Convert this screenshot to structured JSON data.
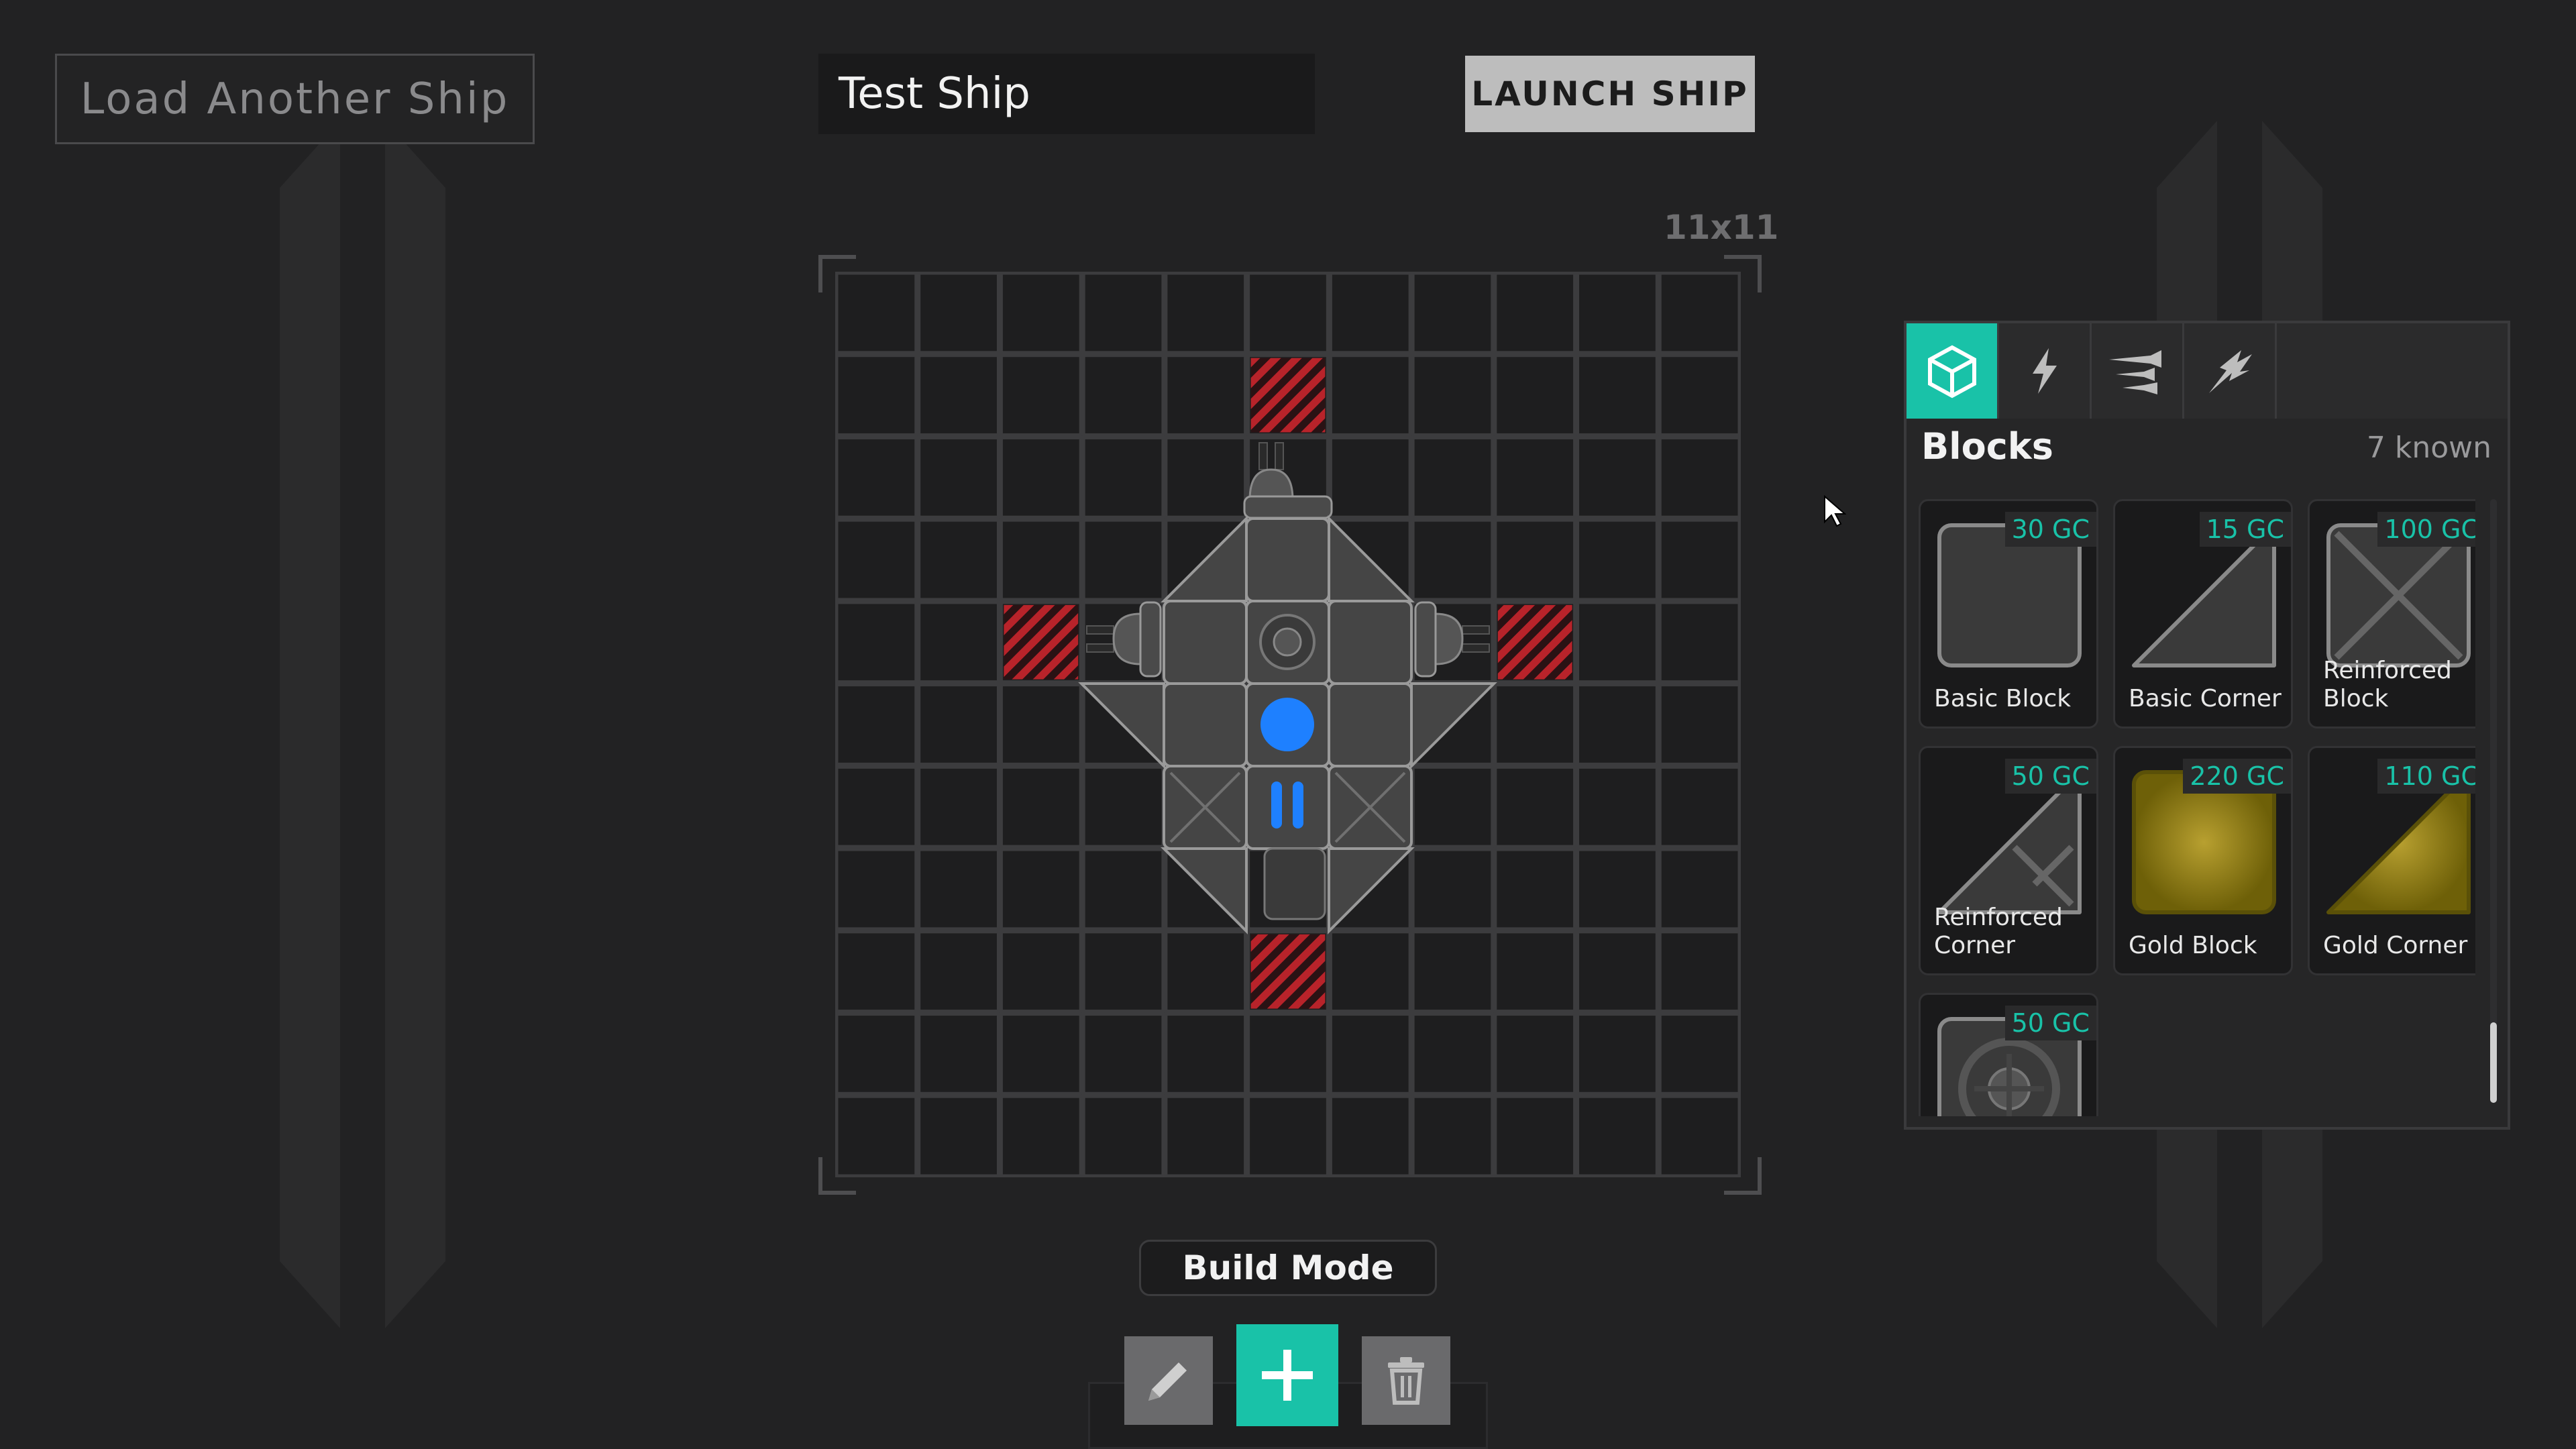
{
  "header": {
    "load_label": "Load Another Ship",
    "ship_name": "Test Ship",
    "launch_label": "LAUNCH SHIP"
  },
  "grid": {
    "size_label": "11x11",
    "cols": 11,
    "rows": 11,
    "blocked_cells": [
      [
        5,
        1
      ],
      [
        2,
        4
      ],
      [
        8,
        4
      ],
      [
        5,
        8
      ]
    ]
  },
  "mode": {
    "label": "Build Mode",
    "tools": [
      "pencil-icon",
      "plus-icon",
      "trash-icon"
    ],
    "active_tool": "plus-icon"
  },
  "palette": {
    "tabs": [
      "cube-icon",
      "lightning-icon",
      "thruster-icon",
      "weapon-icon"
    ],
    "active_tab": "cube-icon",
    "title": "Blocks",
    "count": "7 known",
    "items": [
      {
        "name": "Basic Block",
        "price": "30 GC",
        "kind": "block"
      },
      {
        "name": "Basic Corner",
        "price": "15 GC",
        "kind": "corner"
      },
      {
        "name": "Reinforced Block",
        "price": "100 GC",
        "kind": "reinforced-block"
      },
      {
        "name": "Reinforced Corner",
        "price": "50 GC",
        "kind": "reinforced-corner"
      },
      {
        "name": "Gold Block",
        "price": "220 GC",
        "kind": "gold-block"
      },
      {
        "name": "Gold Corner",
        "price": "110 GC",
        "kind": "gold-corner"
      },
      {
        "name": "",
        "price": "50 GC",
        "kind": "core"
      }
    ]
  },
  "colors": {
    "accent": "#19c2a8",
    "core": "#1e80ff",
    "hazard": "#b8232a",
    "gold": "#8a7a10"
  }
}
